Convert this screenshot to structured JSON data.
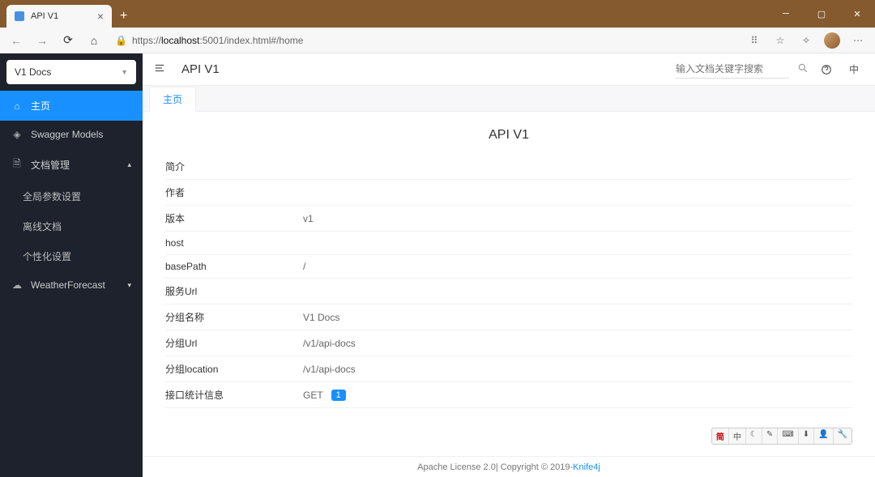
{
  "browser": {
    "tabTitle": "API V1",
    "urlPrefix": "https://",
    "urlHost": "localhost",
    "urlRest": ":5001/index.html#/home"
  },
  "sidebar": {
    "docSelect": "V1 Docs",
    "items": [
      {
        "label": "主页",
        "active": true,
        "icon": "home"
      },
      {
        "label": "Swagger Models",
        "icon": "cube"
      },
      {
        "label": "文档管理",
        "icon": "doc",
        "expanded": true,
        "children": [
          {
            "label": "全局参数设置"
          },
          {
            "label": "离线文档"
          },
          {
            "label": "个性化设置"
          }
        ]
      },
      {
        "label": "WeatherForecast",
        "icon": "cloud",
        "expanded": false
      }
    ]
  },
  "header": {
    "title": "API V1",
    "searchPlaceholder": "输入文档关键字搜索",
    "langToggle": "中"
  },
  "tabs": [
    {
      "label": "主页",
      "active": true
    }
  ],
  "page": {
    "title": "API V1",
    "rows": [
      {
        "k": "简介",
        "v": ""
      },
      {
        "k": "作者",
        "v": ""
      },
      {
        "k": "版本",
        "v": "v1"
      },
      {
        "k": "host",
        "v": ""
      },
      {
        "k": "basePath",
        "v": "/"
      },
      {
        "k": "服务Url",
        "v": ""
      },
      {
        "k": "分组名称",
        "v": "V1 Docs"
      },
      {
        "k": "分组Url",
        "v": "/v1/api-docs"
      },
      {
        "k": "分组location",
        "v": "/v1/api-docs"
      }
    ],
    "statsLabel": "接口统计信息",
    "statsMethod": "GET",
    "statsCount": "1"
  },
  "footer": {
    "license": "Apache License 2.0",
    "copy": " | Copyright © 2019-",
    "link": "Knife4j"
  },
  "ime": [
    "简",
    "中",
    "☾",
    "✎",
    "⌨",
    "⬇",
    "👤",
    "🔧"
  ]
}
